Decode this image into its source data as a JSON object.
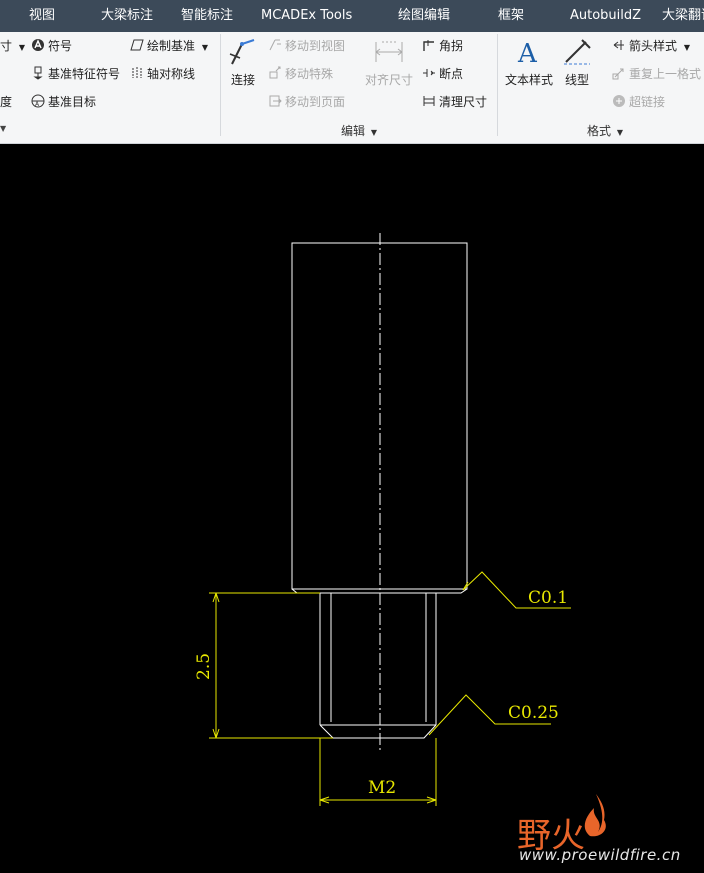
{
  "tabs": [
    {
      "label": "视图"
    },
    {
      "label": "大梁标注"
    },
    {
      "label": "智能标注"
    },
    {
      "label": "MCADEx Tools"
    },
    {
      "label": "绘图编辑"
    },
    {
      "label": "框架"
    },
    {
      "label": "AutobuildZ"
    },
    {
      "label": "大梁翻译"
    }
  ],
  "ribbon": {
    "annotate": {
      "dim_cut": "寸",
      "symbol": "符号",
      "datum_feature_symbol": "基准特征符号",
      "datum_target": "基准目标",
      "degree_cut": "度",
      "sketch_datum": "绘制基准",
      "axis_symmetry": "轴对称线"
    },
    "edit": {
      "connect": "连接",
      "move_to_view": "移动到视图",
      "move_special": "移动特殊",
      "move_to_page": "移动到页面",
      "align_dims": "对齐尺寸",
      "corner": "角拐",
      "breakpoint": "断点",
      "cleanup_dims": "清理尺寸",
      "group_label": "编辑"
    },
    "format": {
      "text_style": "文本样式",
      "line_style": "线型",
      "arrow_style": "箭头样式",
      "repeat_last_format": "重复上一格式",
      "hyperlink": "超链接",
      "group_label": "格式"
    }
  },
  "drawing": {
    "chamfer_top": "C0.1",
    "chamfer_bottom": "C0.25",
    "length_dim": "2.5",
    "thread_dim": "M2"
  },
  "watermark": {
    "brand": "野火",
    "url": "www.proewildfire.cn"
  },
  "colors": {
    "tabbar": "#3c4a59",
    "ribbon": "#f5f6f7",
    "canvas": "#000000",
    "geometry": "#ffffff",
    "dimension": "#e8e800",
    "watermark": "#e8652a"
  }
}
